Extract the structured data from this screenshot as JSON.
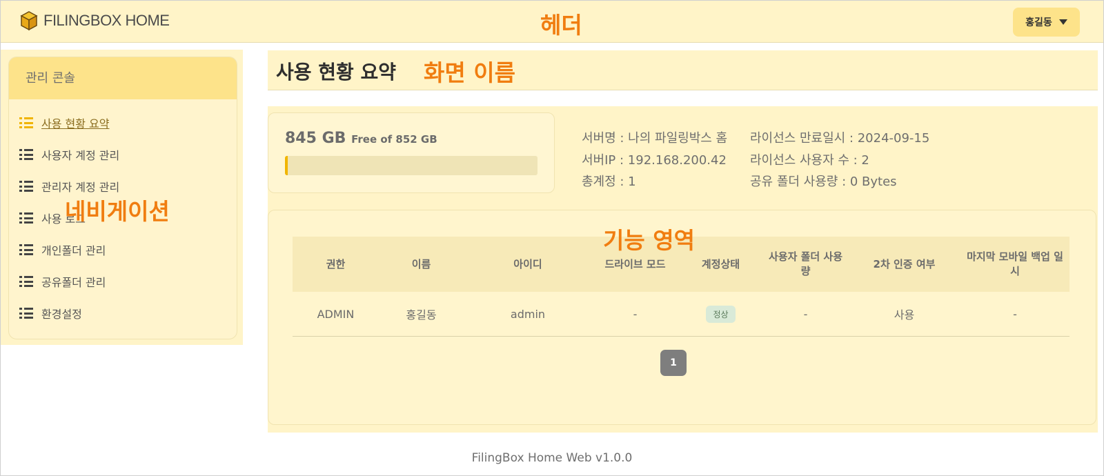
{
  "header": {
    "logo_text": "FILINGBOX HOME",
    "annotation": "헤더",
    "user_name": "홍길동"
  },
  "sidebar": {
    "title": "관리 콘솔",
    "annotation": "네비게이션",
    "items": [
      {
        "label": "사용 현황 요약",
        "active": true
      },
      {
        "label": "사용자 계정 관리"
      },
      {
        "label": "관리자 계정 관리"
      },
      {
        "label": "사용 로그"
      },
      {
        "label": "개인폴더 관리"
      },
      {
        "label": "공유폴더 관리"
      },
      {
        "label": "환경설정"
      }
    ]
  },
  "page": {
    "title": "사용 현황 요약",
    "annotation": "화면 이름"
  },
  "storage": {
    "used_label": "845 GB",
    "total_label": "Free of 852 GB",
    "fill_fraction": 0.01
  },
  "server_info": {
    "server_name": "서버명 : 나의 파일링박스 홈",
    "server_ip": "서버IP : 192.168.200.42",
    "total_accounts": "총계정 : 1",
    "license_expiry": "라이선스 만료일시 : 2024-09-15",
    "license_users": "라이선스 사용자 수 : 2",
    "shared_usage": "공유 폴더 사용량 : 0 Bytes"
  },
  "table": {
    "annotation": "기능 영역",
    "headers": [
      "권한",
      "이름",
      "아이디",
      "드라이브 모드",
      "계정상태",
      "사용자 폴더 사용량",
      "2차 인증 여부",
      "마지막 모바일 백업 일시"
    ],
    "rows": [
      [
        "ADMIN",
        "홍길동",
        "admin",
        "-",
        "정상",
        "-",
        "사용",
        "-"
      ]
    ],
    "current_page": "1"
  },
  "footer": {
    "version": "FilingBox Home Web v1.0.0"
  },
  "colors": {
    "accent": "#f1b500",
    "annotation": "#f07d10",
    "panel_bg": "#fff4c8"
  }
}
